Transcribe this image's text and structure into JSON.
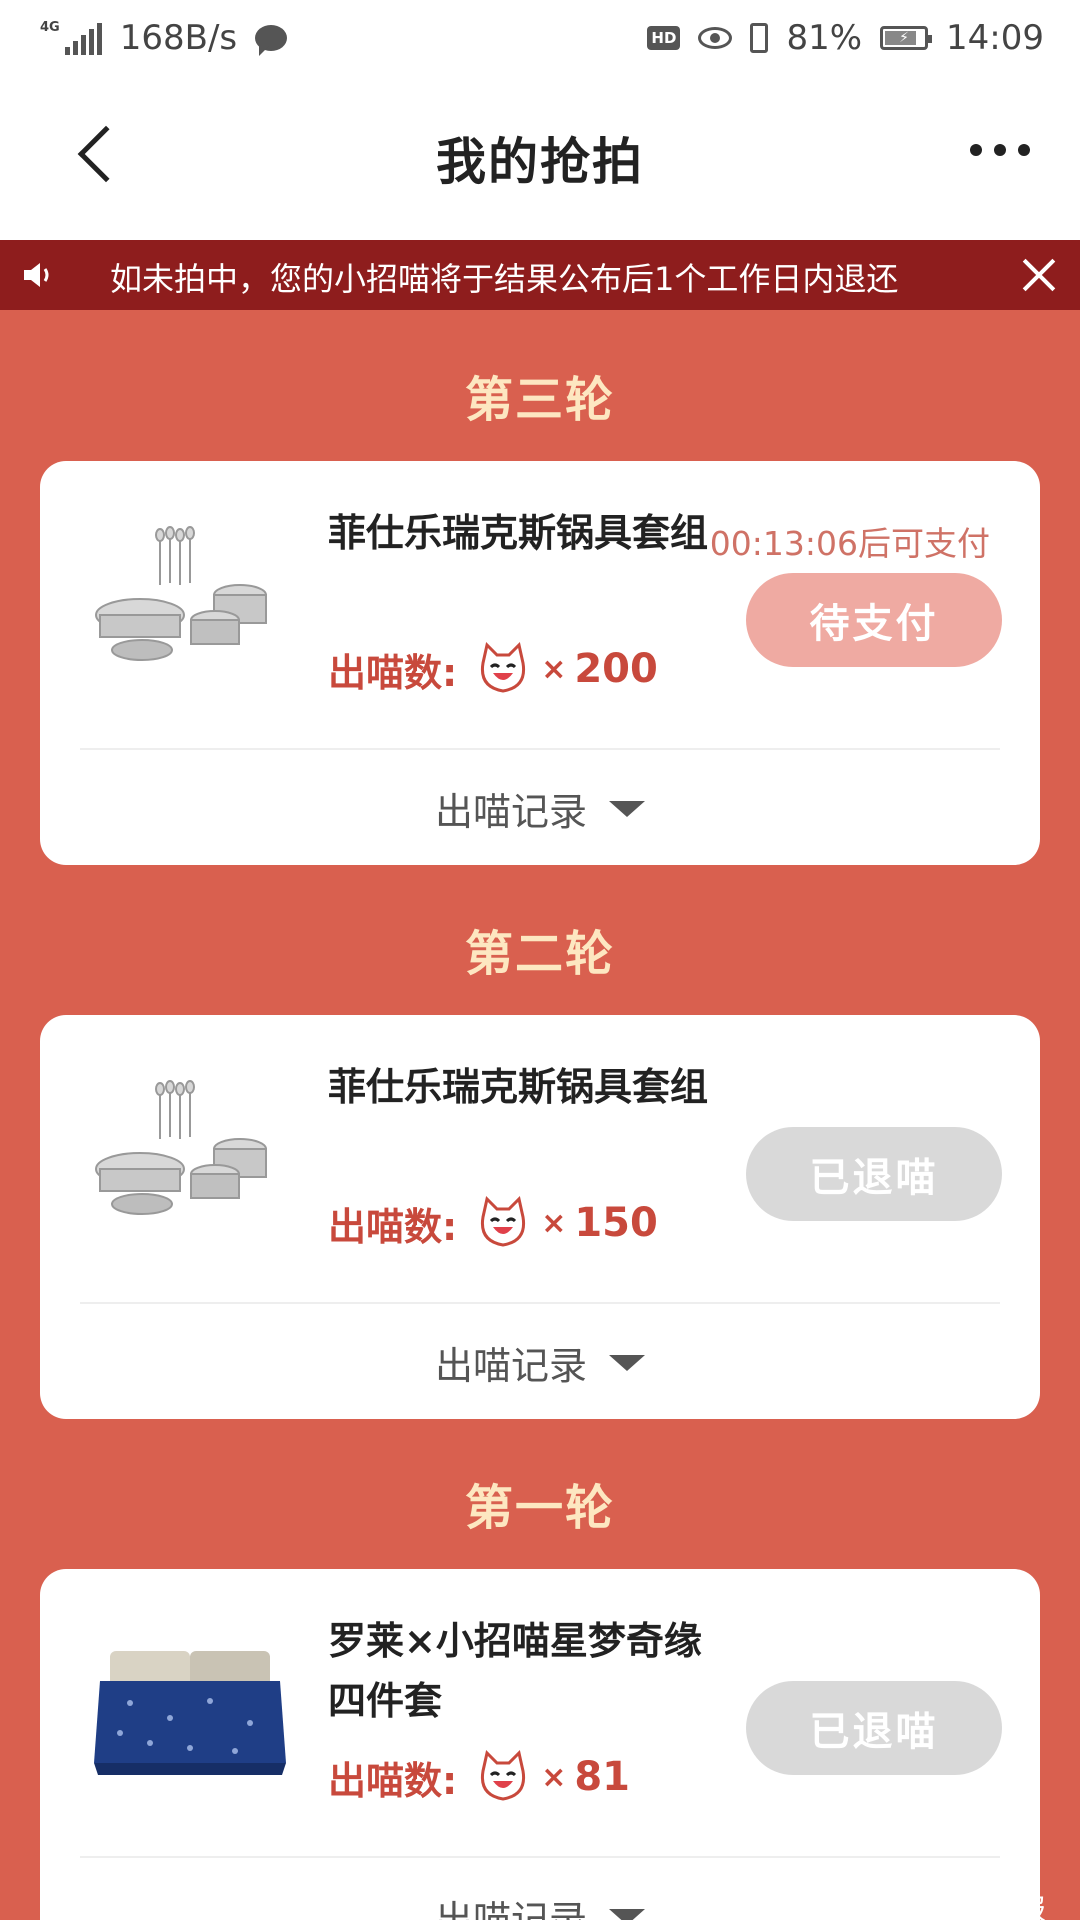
{
  "status_bar": {
    "network": "4G",
    "speed": "168B/s",
    "hd": "HD",
    "battery": "81%",
    "battery_level": 0.81,
    "time": "14:09"
  },
  "nav": {
    "title": "我的抢拍"
  },
  "notice": {
    "text": "如未拍中，您的小招喵将于结果公布后1个工作日内退还"
  },
  "rounds": [
    {
      "title": "第三轮",
      "product_name": "菲仕乐瑞克斯锅具套组",
      "bid_label": "出喵数:",
      "bid_x": "×",
      "bid_count": "200",
      "countdown": "00:13:06后可支付",
      "status": "待支付",
      "record_label": "出喵记录"
    },
    {
      "title": "第二轮",
      "product_name": "菲仕乐瑞克斯锅具套组",
      "bid_label": "出喵数:",
      "bid_x": "×",
      "bid_count": "150",
      "status": "已退喵",
      "record_label": "出喵记录"
    },
    {
      "title": "第一轮",
      "product_name": "罗莱×小招喵星梦奇缘四件套",
      "bid_label": "出喵数:",
      "bid_x": "×",
      "bid_count": "81",
      "status": "已退喵",
      "record_label": "出喵记录"
    }
  ],
  "watermark": "小太阳线报",
  "colors": {
    "page_background": "#d9604f",
    "notice_background": "#8e1d1d",
    "round_title": "#fde7c1",
    "accent_red": "#c8493c",
    "pending_button": "#efaaa2",
    "refunded_button": "#d9d9d9"
  }
}
